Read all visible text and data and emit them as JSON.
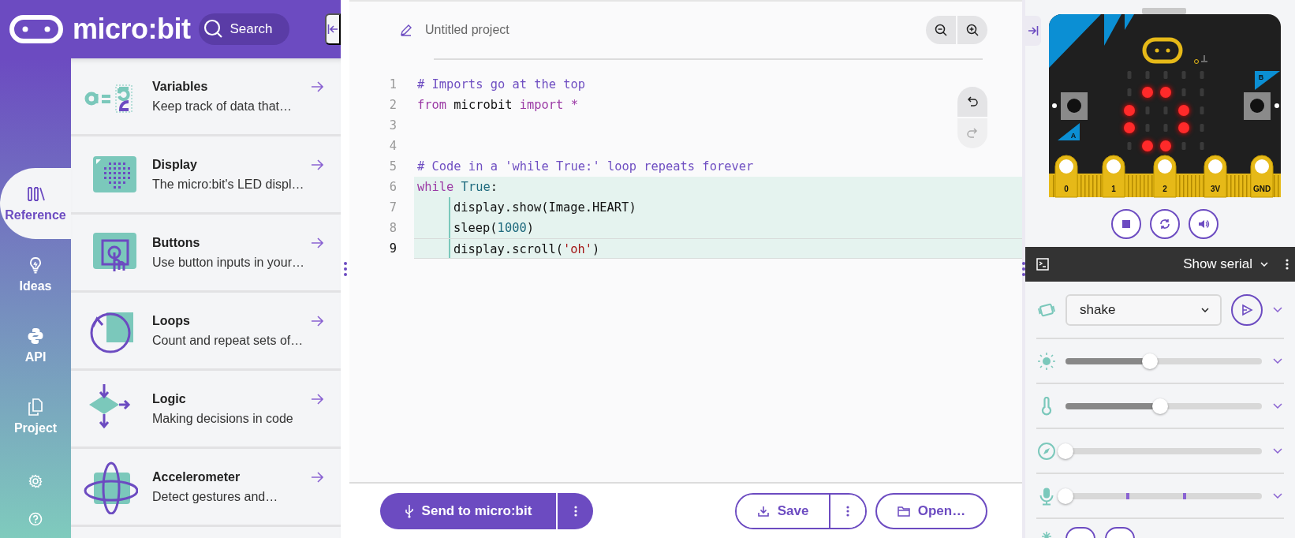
{
  "header": {
    "logo_text": "micro:bit",
    "search": {
      "placeholder": "Search"
    }
  },
  "nav": {
    "items": [
      {
        "label": "Reference",
        "selected": true
      },
      {
        "label": "Ideas",
        "selected": false
      },
      {
        "label": "API",
        "selected": false
      },
      {
        "label": "Project",
        "selected": false
      }
    ]
  },
  "reference": {
    "items": [
      {
        "title": "Variables",
        "description": "Keep track of data that…"
      },
      {
        "title": "Display",
        "description": "The micro:bit's LED displ…"
      },
      {
        "title": "Buttons",
        "description": "Use button inputs in your…"
      },
      {
        "title": "Loops",
        "description": "Count and repeat sets of…"
      },
      {
        "title": "Logic",
        "description": "Making decisions in code"
      },
      {
        "title": "Accelerometer",
        "description": "Detect gestures and…"
      }
    ]
  },
  "editor": {
    "project_name": "Untitled project",
    "lines": [
      {
        "number": "1",
        "highlighted": false,
        "current": false,
        "tokens": [
          {
            "kind": "comment",
            "text": "# Imports go at the top"
          }
        ]
      },
      {
        "number": "2",
        "highlighted": false,
        "current": false,
        "tokens": [
          {
            "kind": "keyword",
            "text": "from"
          },
          {
            "kind": "plain",
            "text": " microbit "
          },
          {
            "kind": "keyword",
            "text": "import"
          },
          {
            "kind": "operator",
            "text": " *"
          }
        ]
      },
      {
        "number": "3",
        "highlighted": false,
        "current": false
      },
      {
        "number": "4",
        "highlighted": false,
        "current": false
      },
      {
        "number": "5",
        "highlighted": false,
        "current": false,
        "tokens": [
          {
            "kind": "comment",
            "text": "# Code in a 'while True:' loop repeats forever"
          }
        ]
      },
      {
        "number": "6",
        "highlighted": true,
        "current": false,
        "tokens": [
          {
            "kind": "keyword",
            "text": "while"
          },
          {
            "kind": "constant",
            "text": " True"
          },
          {
            "kind": "plain",
            "text": ":"
          }
        ],
        "children": [
          {
            "number": "7",
            "current": false,
            "tokens": [
              {
                "kind": "plain",
                "text": "display.show(Image.HEART)"
              }
            ]
          },
          {
            "number": "8",
            "current": false,
            "tokens": [
              {
                "kind": "plain",
                "text": "sleep("
              },
              {
                "kind": "number",
                "text": "1000"
              },
              {
                "kind": "plain",
                "text": ")"
              }
            ]
          },
          {
            "number": "9",
            "current": true,
            "tokens": [
              {
                "kind": "plain",
                "text": "display.scroll("
              },
              {
                "kind": "string",
                "text": "'oh'"
              },
              {
                "kind": "plain",
                "text": ")"
              }
            ]
          }
        ]
      }
    ]
  },
  "footer": {
    "send": "Send to micro:bit",
    "save": "Save",
    "open": "Open…"
  },
  "simulator": {
    "leds": [
      [
        false,
        false,
        false,
        false,
        false
      ],
      [
        false,
        true,
        true,
        false,
        false
      ],
      [
        true,
        false,
        false,
        true,
        false
      ],
      [
        true,
        false,
        false,
        true,
        false
      ],
      [
        false,
        true,
        true,
        false,
        false
      ]
    ],
    "buttons": [
      "A",
      "B"
    ],
    "pins": [
      "0",
      "1",
      "2",
      "3V",
      "GND"
    ]
  },
  "serial": {
    "label": "Show serial"
  },
  "sensors": [
    {
      "kind": "gesture",
      "value": "shake"
    },
    {
      "kind": "light",
      "level": 0.43
    },
    {
      "kind": "temperature",
      "level": 0.48
    },
    {
      "kind": "compass",
      "level": 0
    },
    {
      "kind": "sound",
      "level": 0
    },
    {
      "kind": "buttons"
    }
  ]
}
